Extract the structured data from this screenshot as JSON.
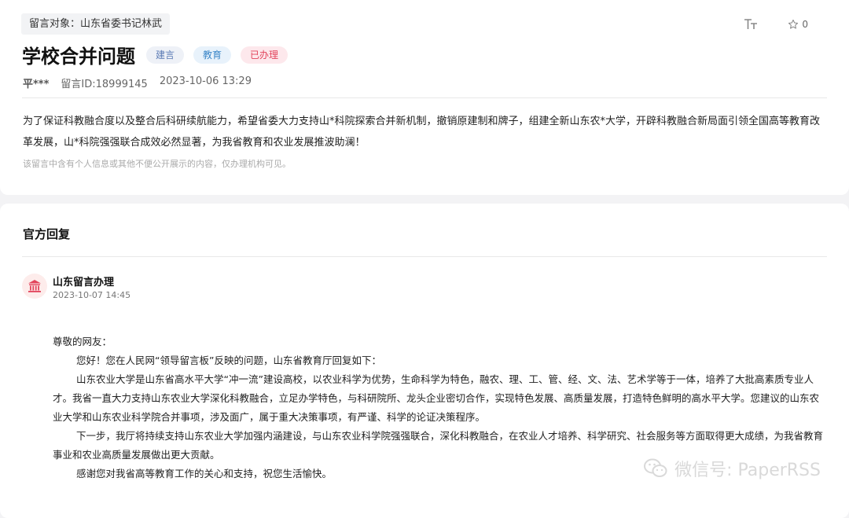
{
  "message": {
    "target": "留言对象：山东省委书记林武",
    "title": "学校合并问题",
    "tags": [
      {
        "label": "建言",
        "bg": "#eef1f7",
        "color": "#5b7bb5"
      },
      {
        "label": "教育",
        "bg": "#e8f2fb",
        "color": "#3a86c8"
      },
      {
        "label": "已办理",
        "bg": "#fde8ec",
        "color": "#e2445c"
      }
    ],
    "author": "平***",
    "message_id": "留言ID:18999145",
    "datetime": "2023-10-06 13:29",
    "content": "为了保证科教融合度以及整合后科研续航能力，希望省委大力支持山*科院探索合并新机制，撤销原建制和牌子，组建全新山东农*大学，开辟科教融合新局面引领全国高等教育改革发展，山*科院强强联合成效必然显著，为我省教育和农业发展推波助澜！",
    "privacy_note": "该留言中含有个人信息或其他不便公开展示的内容，仅办理机构可见。",
    "star_count": "0"
  },
  "reply": {
    "section_title": "官方回复",
    "org": "山东留言办理",
    "time": "2023-10-07 14:45",
    "greeting": "尊敬的网友：",
    "paragraphs": [
      "您好！您在人民网“领导留言板”反映的问题，山东省教育厅回复如下：",
      "山东农业大学是山东省高水平大学“冲一流”建设高校，以农业科学为优势，生命科学为特色，融农、理、工、管、经、文、法、艺术学等于一体，培养了大批高素质专业人才。我省一直大力支持山东农业大学深化科教融合，立足办学特色，与科研院所、龙头企业密切合作，实现特色发展、高质量发展，打造特色鲜明的高水平大学。您建议的山东农业大学和山东农业科学院合并事项，涉及面广，属于重大决策事项，有严谨、科学的论证决策程序。",
      "下一步，我厅将持续支持山东农业大学加强内涵建设，与山东农业科学院强强联合，深化科教融合，在农业人才培养、科学研究、社会服务等方面取得更大成绩，为我省教育事业和农业高质量发展做出更大贡献。",
      "感谢您对我省高等教育工作的关心和支持，祝您生活愉快。"
    ]
  },
  "watermark": "微信号: PaperRSS",
  "icons": {
    "font_size": "font-size-icon",
    "star": "star-icon",
    "avatar": "government-building-icon",
    "watermark": "wechat-icon"
  },
  "colors": {
    "accent_red": "#e2445c",
    "avatar_bg": "#fdeceb"
  }
}
